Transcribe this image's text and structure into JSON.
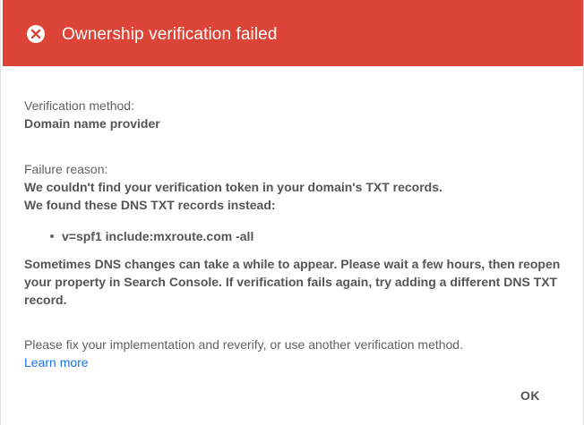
{
  "header": {
    "title": "Ownership verification failed",
    "icon": "error-circle-icon",
    "background_color": "#db4437"
  },
  "method": {
    "label": "Verification method:",
    "value": "Domain name provider"
  },
  "failure": {
    "label": "Failure reason:",
    "line1": "We couldn't find your verification token in your domain's TXT records.",
    "line2": "We found these DNS TXT records instead:",
    "records": [
      "v=spf1 include:mxroute.com -all"
    ],
    "note": "Sometimes DNS changes can take a while to appear. Please wait a few hours, then reopen your property in Search Console. If verification fails again, try adding a different DNS TXT record."
  },
  "footer": {
    "instruction": "Please fix your implementation and reverify, or use another verification method.",
    "learn_more": "Learn more",
    "link_color": "#1a73e8"
  },
  "actions": {
    "ok_label": "OK"
  }
}
